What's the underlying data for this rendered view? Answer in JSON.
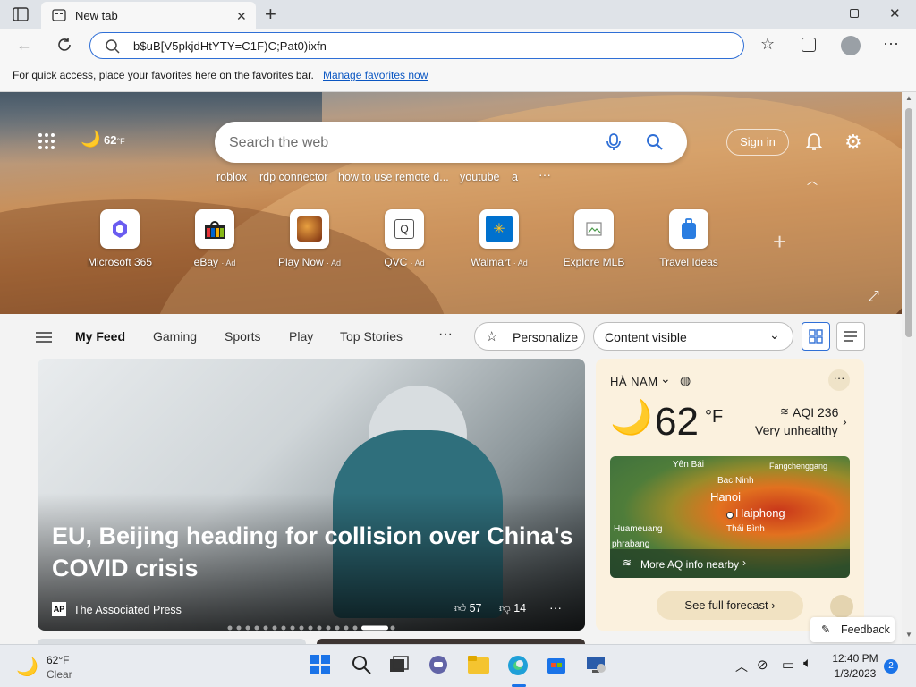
{
  "browser": {
    "tab_title": "New tab",
    "address_value": "b$uB[V5pkjdHtYTY=C1F)C;Pat0)ixfn",
    "favbar_message": "For quick access, place your favorites here on the favorites bar.",
    "favbar_link": "Manage favorites now"
  },
  "hero": {
    "weather_temp": "62",
    "weather_unit": "°F",
    "search_placeholder": "Search the web",
    "suggestions": [
      "roblox",
      "rdp connector",
      "how to use remote d...",
      "youtube",
      "a"
    ],
    "signin_label": "Sign in",
    "tiles": [
      {
        "label": "Microsoft 365",
        "ad": ""
      },
      {
        "label": "eBay",
        "ad": "· Ad"
      },
      {
        "label": "Play Now",
        "ad": "· Ad"
      },
      {
        "label": "QVC",
        "ad": "· Ad"
      },
      {
        "label": "Walmart",
        "ad": "· Ad"
      },
      {
        "label": "Explore MLB",
        "ad": ""
      },
      {
        "label": "Travel Ideas",
        "ad": ""
      }
    ]
  },
  "feed_nav": {
    "tabs": [
      "My Feed",
      "Gaming",
      "Sports",
      "Play",
      "Top Stories"
    ],
    "personalize_label": "Personalize",
    "content_visible_label": "Content visible"
  },
  "main_story": {
    "title": "EU, Beijing heading for collision over China's COVID crisis",
    "source": "The Associated Press",
    "source_badge": "AP",
    "likes": "57",
    "dislikes": "14"
  },
  "weather_card": {
    "location": "HÀ NAM",
    "temp": "62",
    "unit": "°F",
    "aqi": "AQI 236",
    "aqi_status": "Very unhealthy",
    "map_labels": [
      "Yên Bái",
      "Bac Ninh",
      "Fangchenggang",
      "Hanoi",
      "Haiphong",
      "Huameuang",
      "Thái Bình",
      "phrabang"
    ],
    "more_aq": "More AQ info nearby",
    "forecast_button": "See full forecast"
  },
  "feedback_label": "Feedback",
  "taskbar": {
    "weather_temp": "62°F",
    "weather_desc": "Clear",
    "time": "12:40 PM",
    "date": "1/3/2023",
    "notification_count": "2"
  },
  "colors": {
    "accent": "#2f6fd6",
    "link": "#0a56c2",
    "weather_bg": "#fbf1de"
  }
}
